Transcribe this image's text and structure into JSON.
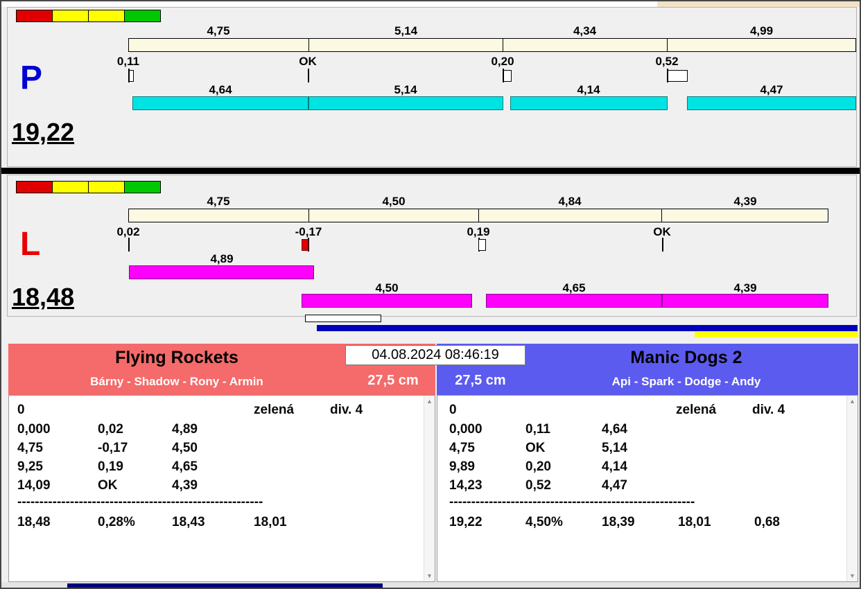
{
  "icons": {
    "scroll_up": "▲",
    "scroll_down": "▼"
  },
  "colors": {
    "split_bar": "#fcf9e2",
    "p_bar": "#00e3e3",
    "l_bar": "#ff00ff",
    "fault": "#dd0000",
    "blue_progress": "#0000bb",
    "yellow_progress": "#ffff00",
    "bottom_navy": "#000080",
    "top_beige": "#f2e3c6"
  },
  "panel_p": {
    "letter": "P",
    "letter_color": "#0000d2",
    "total": "19,22",
    "lights": [
      "#e10000",
      "#ffff00",
      "#ffff00",
      "#00c800"
    ],
    "splits": [
      "4,75",
      "5,14",
      "4,34",
      "4,99"
    ],
    "crossings": [
      "0,11",
      "OK",
      "0,20",
      "0,52"
    ],
    "dog_times": [
      "4,64",
      "5,14",
      "4,14",
      "4,47"
    ]
  },
  "panel_l": {
    "letter": "L",
    "letter_color": "#e80000",
    "total": "18,48",
    "lights": [
      "#e10000",
      "#ffff00",
      "#ffff00",
      "#00c800"
    ],
    "splits": [
      "4,75",
      "4,50",
      "4,84",
      "4,39"
    ],
    "crossings": [
      "0,02",
      "-0,17",
      "0,19",
      "OK"
    ],
    "dog_times": [
      "4,89",
      "4,50",
      "4,65",
      "4,39"
    ]
  },
  "timestamp": "04.08.2024 08:46:19",
  "team_left": {
    "name": "Flying Rockets",
    "lineup": "Bárny - Shadow - Rony - Armin",
    "jump_height": "27,5 cm",
    "color": "#f56a6a",
    "header_row": {
      "c1": "0",
      "c4": "zelená",
      "c5": "div. 4"
    },
    "rows": [
      [
        "0,000",
        "0,02",
        "4,89"
      ],
      [
        "4,75",
        "-0,17",
        "4,50"
      ],
      [
        "9,25",
        "0,19",
        "4,65"
      ],
      [
        "14,09",
        "OK",
        "4,39"
      ]
    ],
    "divider": "--------------------------------------------------------",
    "summary": [
      "18,48",
      "0,28%",
      "18,43",
      "18,01"
    ]
  },
  "team_right": {
    "name": "Manic Dogs 2",
    "lineup": "Api - Spark - Dodge - Andy",
    "jump_height": "27,5 cm",
    "color": "#5b5bef",
    "header_row": {
      "c1": "0",
      "c4": "zelená",
      "c5": "div. 4"
    },
    "rows": [
      [
        "0,000",
        "0,11",
        "4,64"
      ],
      [
        "4,75",
        "OK",
        "5,14"
      ],
      [
        "9,89",
        "0,20",
        "4,14"
      ],
      [
        "14,23",
        "0,52",
        "4,47"
      ]
    ],
    "divider": "--------------------------------------------------------",
    "summary": [
      "19,22",
      "4,50%",
      "18,39",
      "18,01",
      "0,68"
    ]
  }
}
